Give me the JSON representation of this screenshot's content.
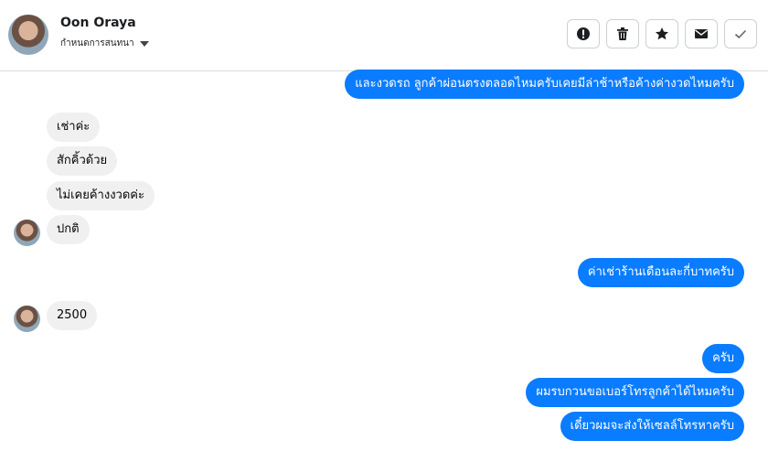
{
  "header": {
    "contact_name": "Oon Oraya",
    "subtitle": "กำหนดการสนทนา"
  },
  "toolbar": {
    "buttons": [
      {
        "icon": "alert-icon",
        "label": "!"
      },
      {
        "icon": "trash-icon",
        "label": "trash"
      },
      {
        "icon": "star-icon",
        "label": "star"
      },
      {
        "icon": "mail-icon",
        "label": "mail"
      },
      {
        "icon": "check-icon",
        "label": "check"
      }
    ]
  },
  "messages": [
    {
      "dir": "out",
      "text": "และงวดรถ ลูกค้าผ่อนตรงตลอดไหมครับเคยมีล่าช้าหรือค้างค่างวดไหมครับ"
    },
    {
      "dir": "in",
      "text": "เช่าค่ะ"
    },
    {
      "dir": "in",
      "text": "สักคิ้วด้วย"
    },
    {
      "dir": "in",
      "text": "ไม่เคยค้างงวดค่ะ"
    },
    {
      "dir": "in",
      "text": "ปกติ"
    },
    {
      "dir": "out",
      "text": "ค่าเช่าร้านเดือนละกี่บาทครับ"
    },
    {
      "dir": "in",
      "text": "2500"
    },
    {
      "dir": "out",
      "text": "ครับ"
    },
    {
      "dir": "out",
      "text": "ผมรบกวนขอเบอร์โทรลูกค้าได้ไหมครับ"
    },
    {
      "dir": "out",
      "text": "เดี๋ยวผมจะส่งให้เซลล์โทรหาครับ"
    }
  ],
  "colors": {
    "outgoing_bubble": "#0a7cff",
    "incoming_bubble": "#f0f0f0"
  }
}
